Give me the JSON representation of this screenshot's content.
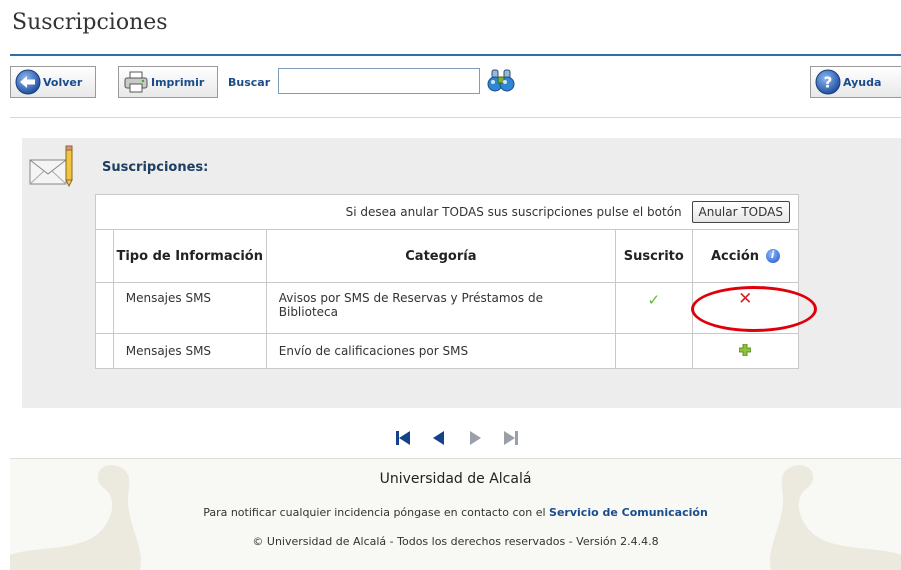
{
  "page": {
    "title": "Suscripciones"
  },
  "toolbar": {
    "back_label": "Volver",
    "print_label": "Imprimir",
    "search_label": "Buscar",
    "search_value": "",
    "help_label": "Ayuda"
  },
  "section": {
    "title": "Suscripciones:",
    "notice": "Si desea anular TODAS sus suscripciones pulse el botón",
    "cancel_all_label": "Anular TODAS"
  },
  "table": {
    "headers": {
      "tipo": "Tipo de Información",
      "categoria": "Categoría",
      "suscrito": "Suscrito",
      "accion": "Acción"
    },
    "rows": [
      {
        "tipo": "Mensajes SMS",
        "categoria": "Avisos por SMS de Reservas y Préstamos de Biblioteca",
        "suscrito": true,
        "accion": "remove"
      },
      {
        "tipo": "Mensajes SMS",
        "categoria": "Envío de calificaciones por SMS",
        "suscrito": false,
        "accion": "add"
      }
    ]
  },
  "icons": {
    "check": "✓",
    "remove": "✕",
    "info": "i"
  },
  "footer": {
    "title": "Universidad de Alcalá",
    "notice_prefix": "Para notificar cualquier incidencia póngase en contacto con el",
    "notice_link": "Servicio de Comunicación",
    "copyright": "© Universidad de Alcalá - Todos los derechos reservados - Versión 2.4.4.8"
  },
  "colors": {
    "accent": "#1a4c8c",
    "rule": "#2f6fa8",
    "highlight": "#e0000a",
    "panel": "#ededed"
  }
}
